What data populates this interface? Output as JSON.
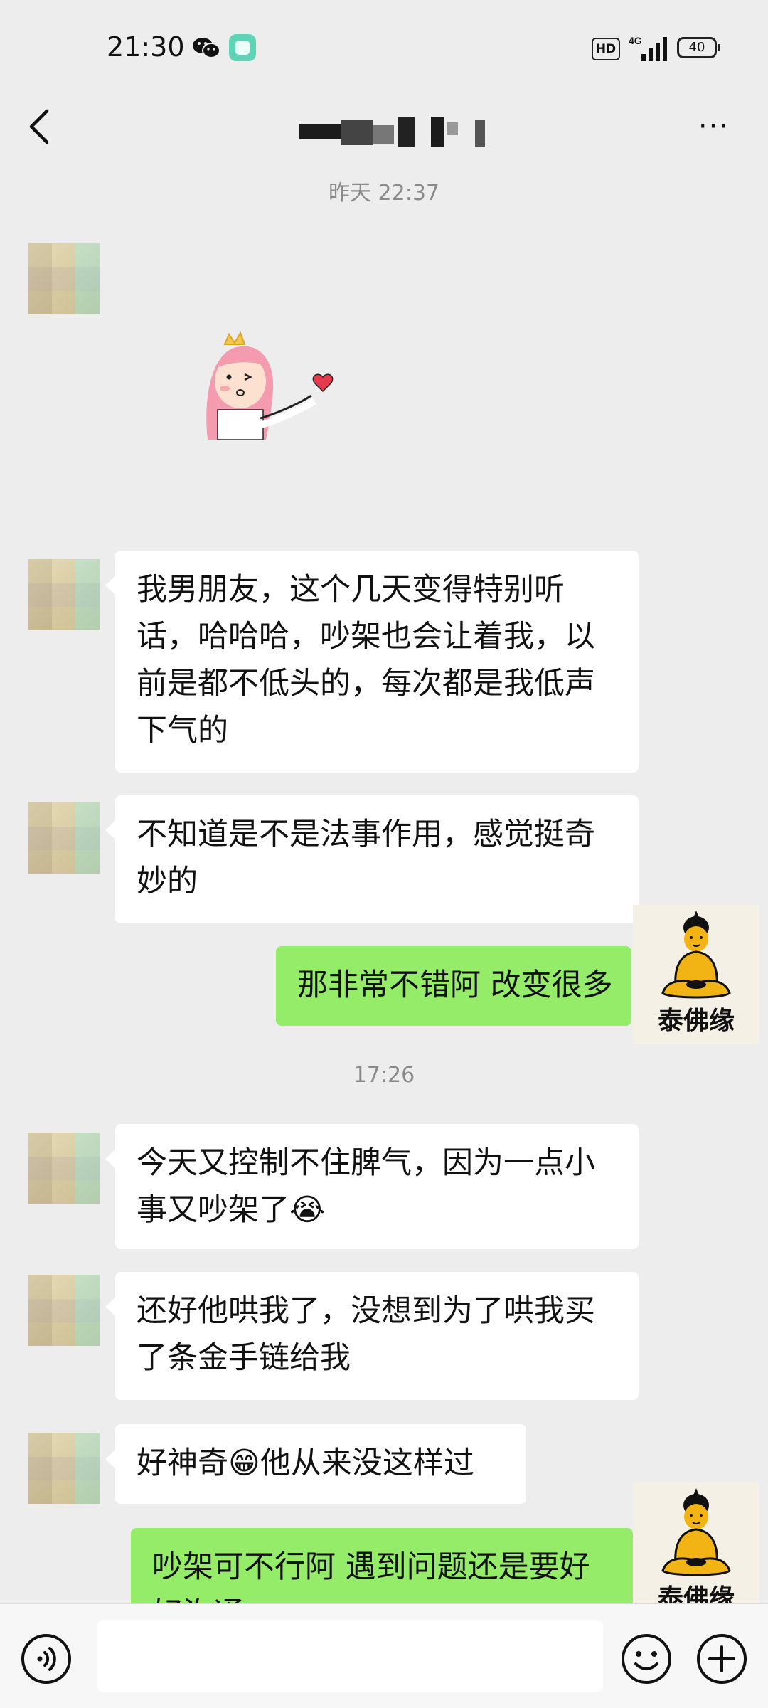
{
  "status_bar": {
    "time": "21:30",
    "hd_badge": "HD",
    "network": "4G",
    "battery": "40"
  },
  "nav": {
    "title": "",
    "back_icon": "chevron-left-icon",
    "more_icon": "more-dots-icon"
  },
  "timestamps": {
    "first": "昨天 22:37",
    "second": "17:26"
  },
  "messages": [
    {
      "side": "in",
      "type": "sticker",
      "content": "girl-blowing-kiss-sticker"
    },
    {
      "side": "in",
      "type": "text",
      "text": "我男朋友，这个几天变得特别听话，哈哈哈，吵架也会让着我，以前是都不低头的，每次都是我低声下气的"
    },
    {
      "side": "in",
      "type": "text",
      "text": "不知道是不是法事作用，感觉挺奇妙的"
    },
    {
      "side": "out",
      "type": "text",
      "text": "那非常不错阿 改变很多"
    },
    {
      "side": "in",
      "type": "text",
      "text": "今天又控制不住脾气，因为一点小事又吵架了😭"
    },
    {
      "side": "in",
      "type": "text",
      "text": "还好他哄我了，没想到为了哄我买了条金手链给我"
    },
    {
      "side": "in",
      "type": "text",
      "text": "好神奇😁他从来没这样过"
    },
    {
      "side": "out",
      "type": "text",
      "text": "吵架可不行阿 遇到问题还是要好好沟通"
    }
  ],
  "watermark": {
    "text": "泰佛缘"
  },
  "input_bar": {
    "voice_icon": "voice-icon",
    "emoji_icon": "emoji-icon",
    "plus_icon": "plus-icon",
    "placeholder": ""
  },
  "colors": {
    "background": "#ededed",
    "bubble_in": "#ffffff",
    "bubble_out": "#95ec69",
    "timestamp": "#8a8a8a"
  }
}
